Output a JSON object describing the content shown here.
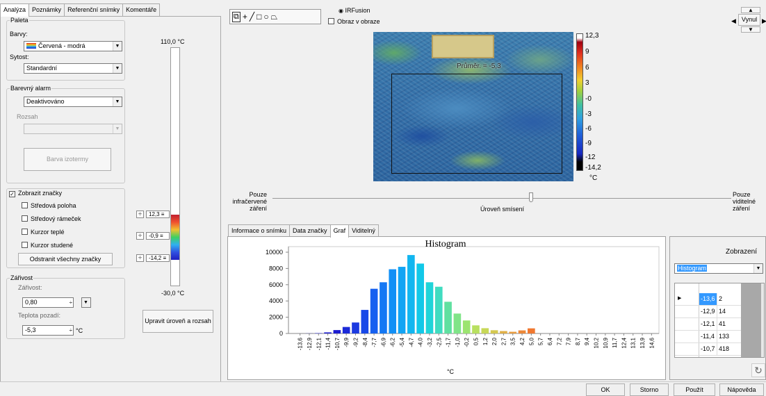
{
  "tabs_left": [
    "Analýza",
    "Poznámky",
    "Referenční snímky",
    "Komentáře"
  ],
  "palette": {
    "group_label": "Paleta",
    "colors_label": "Barvy:",
    "colors_value": "Červená - modrá",
    "saturation_label": "Sytost:",
    "saturation_value": "Standardní"
  },
  "alarm": {
    "group_label": "Barevný alarm",
    "value": "Deaktivováno",
    "range_label": "Rozsah",
    "range_value": "",
    "isotherm_button": "Barva izotermy"
  },
  "markers": {
    "show_label": "Zobrazit značky",
    "show_checked": true,
    "items": [
      "Středová poloha",
      "Středový rámeček",
      "Kurzor teplé",
      "Kurzor studené"
    ],
    "remove_button": "Odstranit všechny značky"
  },
  "emissivity": {
    "group_label": "Zářivost",
    "emissivity_label": "Zářivost:",
    "emissivity_value": "0,80",
    "bg_label": "Teplota pozadí:",
    "bg_value": "-5,3",
    "bg_unit": "°C"
  },
  "scale": {
    "max_label": "110,0 °C",
    "min_label": "-30,0 °C",
    "hi_value": "12,3",
    "mid_value": "-0,9",
    "lo_value": "-14,2"
  },
  "adjust_button": "Upravit úroveň a rozsah",
  "irfusion": {
    "option_label": "IRFusion",
    "pip_label": "Obraz v obraze"
  },
  "unlock_button": "Vynul",
  "thermal": {
    "marker_label": "Průměr. = -5,3",
    "colorbar_ticks": [
      "12,3",
      "9",
      "6",
      "3",
      "-0",
      "-3",
      "-6",
      "-9",
      "-12",
      "-14,2"
    ],
    "colorbar_unit": "°C"
  },
  "blend": {
    "left_label": "Pouze infračervené záření",
    "right_label": "Pouze viditelné záření",
    "center_label": "Úroveň smísení"
  },
  "tabs_bottom": [
    "Informace o snímku",
    "Data značky",
    "Graf",
    "Viditelný"
  ],
  "view": {
    "label": "Zobrazení",
    "value": "Histogram"
  },
  "table_rows": [
    {
      "temp": "-13,6",
      "count": "2"
    },
    {
      "temp": "-12,9",
      "count": "14"
    },
    {
      "temp": "-12,1",
      "count": "41"
    },
    {
      "temp": "-11,4",
      "count": "133"
    },
    {
      "temp": "-10,7",
      "count": "418"
    }
  ],
  "dialog_buttons": {
    "ok": "OK",
    "cancel": "Storno",
    "apply": "Použít",
    "help": "Nápověda"
  },
  "chart_data": {
    "type": "bar",
    "title": "Histogram",
    "xlabel": "°C",
    "ylabel": "",
    "ylim": [
      0,
      10000
    ],
    "yticks": [
      "0",
      "2000",
      "4000",
      "6000",
      "8000",
      "10000"
    ],
    "categories": [
      "-13,6",
      "-12,9",
      "-12,1",
      "-11,4",
      "-10,7",
      "-9,9",
      "-9,2",
      "-8,4",
      "-7,7",
      "-6,9",
      "-6,2",
      "-5,4",
      "-4,7",
      "-4,0",
      "-3,2",
      "-2,5",
      "-1,7",
      "-1,0",
      "-0,2",
      "0,5",
      "1,2",
      "2,0",
      "2,7",
      "3,5",
      "4,2",
      "5,0",
      "5,7",
      "6,4",
      "7,2",
      "7,9",
      "8,7",
      "9,4",
      "10,2",
      "10,9",
      "11,7",
      "12,4",
      "13,1",
      "13,9",
      "14,6"
    ],
    "values": [
      2,
      14,
      41,
      133,
      418,
      800,
      1350,
      2900,
      5500,
      6300,
      7900,
      8200,
      9650,
      8600,
      6300,
      5750,
      3900,
      2450,
      1600,
      1000,
      650,
      400,
      300,
      210,
      380,
      630,
      0,
      0,
      0,
      0,
      0,
      0,
      0,
      0,
      0,
      0,
      0,
      0,
      0
    ],
    "colors": [
      "#1c1cd0",
      "#1c1cd0",
      "#1c1cd0",
      "#1c1cd0",
      "#1c1cd0",
      "#1c2ad8",
      "#1c3ae0",
      "#1848e8",
      "#1660f0",
      "#1478f4",
      "#1290f6",
      "#12a4f4",
      "#12b6f0",
      "#12c8e8",
      "#20d4d8",
      "#40dcc0",
      "#60e0a0",
      "#80e488",
      "#9ce470",
      "#b8e060",
      "#c8d858",
      "#d4c850",
      "#e0b048",
      "#e89c40",
      "#ec8838",
      "#f07830",
      "#f07830",
      "#f07830",
      "#f07830",
      "#f07830",
      "#f07830",
      "#f07830",
      "#f07830",
      "#f07830",
      "#f07830",
      "#f07830",
      "#f07830",
      "#f07830",
      "#f07830"
    ]
  }
}
